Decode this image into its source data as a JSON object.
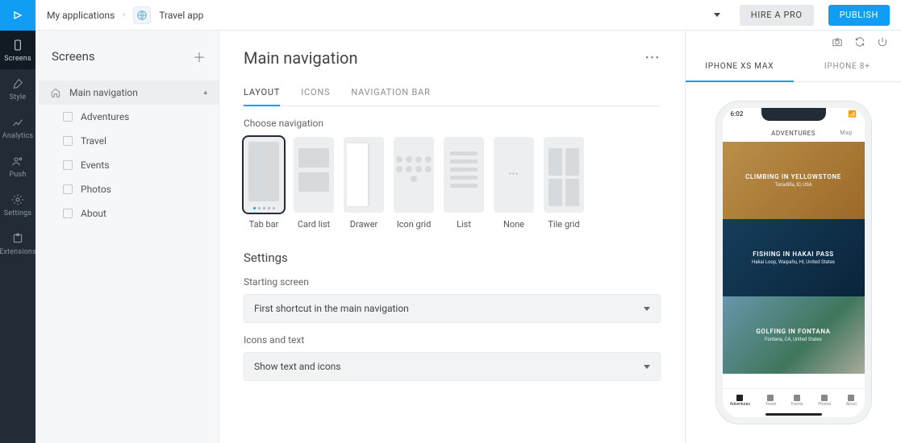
{
  "rail": {
    "items": [
      {
        "label": "Screens"
      },
      {
        "label": "Style"
      },
      {
        "label": "Analytics"
      },
      {
        "label": "Push"
      },
      {
        "label": "Settings"
      },
      {
        "label": "Extensions"
      }
    ]
  },
  "breadcrumb": {
    "root": "My applications",
    "app": "Travel app"
  },
  "top": {
    "hire": "HIRE A PRO",
    "publish": "PUBLISH"
  },
  "screens": {
    "title": "Screens",
    "items": [
      {
        "label": "Main navigation"
      },
      {
        "label": "Adventures"
      },
      {
        "label": "Travel"
      },
      {
        "label": "Events"
      },
      {
        "label": "Photos"
      },
      {
        "label": "About"
      }
    ]
  },
  "center": {
    "title": "Main navigation",
    "tabs": [
      {
        "label": "LAYOUT"
      },
      {
        "label": "ICONS"
      },
      {
        "label": "NAVIGATION BAR"
      }
    ],
    "choose_label": "Choose navigation",
    "nav_options": [
      {
        "label": "Tab bar"
      },
      {
        "label": "Card list"
      },
      {
        "label": "Drawer"
      },
      {
        "label": "Icon grid"
      },
      {
        "label": "List"
      },
      {
        "label": "None"
      },
      {
        "label": "Tile grid"
      }
    ],
    "settings_title": "Settings",
    "fields": {
      "start_label": "Starting screen",
      "start_value": "First shortcut in the main navigation",
      "icons_label": "Icons and text",
      "icons_value": "Show text and icons"
    }
  },
  "preview": {
    "tabs": [
      {
        "label": "IPHONE XS MAX"
      },
      {
        "label": "IPHONE 8+"
      }
    ],
    "status_time": "6:02",
    "app_title": "ADVENTURES",
    "app_right": "Map",
    "cards": [
      {
        "title": "CLIMBING IN YELLOWSTONE",
        "sub": "Tocadilla, ID, USA"
      },
      {
        "title": "FISHING IN HAKAI PASS",
        "sub": "Hakai Loop, Waipahu, HI, United States"
      },
      {
        "title": "GOLFING IN FONTANA",
        "sub": "Fontana, CA, United States"
      }
    ],
    "tabbar": [
      {
        "label": "Adventures"
      },
      {
        "label": "Travel"
      },
      {
        "label": "Events"
      },
      {
        "label": "Photos"
      },
      {
        "label": "About"
      }
    ]
  }
}
